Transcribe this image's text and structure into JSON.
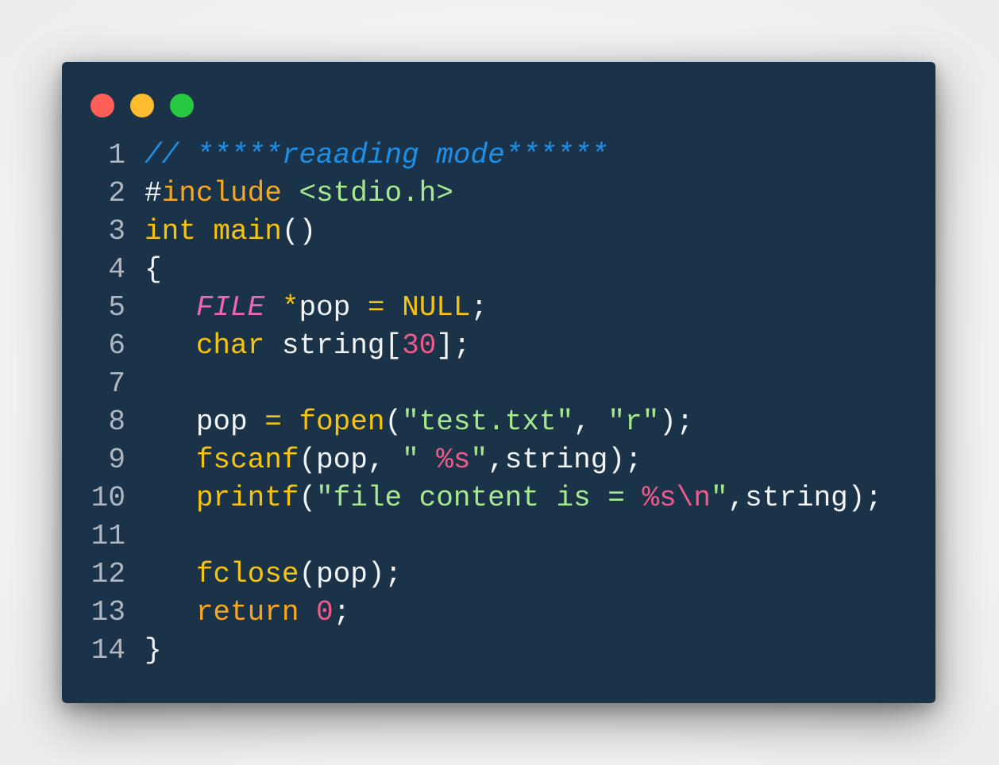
{
  "window": {
    "dots": [
      {
        "name": "close",
        "color": "#ff5f57"
      },
      {
        "name": "minimize",
        "color": "#febc2e"
      },
      {
        "name": "maximize",
        "color": "#28c840"
      }
    ]
  },
  "code": {
    "lines": [
      {
        "n": "1",
        "tokens": [
          [
            "cm",
            "// *****reaading mode******"
          ]
        ]
      },
      {
        "n": "2",
        "tokens": [
          [
            "pl",
            "#"
          ],
          [
            "kw",
            "include"
          ],
          [
            "pl",
            " "
          ],
          [
            "st",
            "<stdio.h>"
          ]
        ]
      },
      {
        "n": "3",
        "tokens": [
          [
            "ty",
            "int"
          ],
          [
            "pl",
            " "
          ],
          [
            "fn",
            "main"
          ],
          [
            "pl",
            "()"
          ]
        ]
      },
      {
        "n": "4",
        "tokens": [
          [
            "pl",
            "{"
          ]
        ]
      },
      {
        "n": "5",
        "tokens": [
          [
            "pl",
            "   "
          ],
          [
            "mac",
            "FILE"
          ],
          [
            "pl",
            " "
          ],
          [
            "op",
            "*"
          ],
          [
            "pl",
            "pop "
          ],
          [
            "op",
            "="
          ],
          [
            "pl",
            " "
          ],
          [
            "ty",
            "NULL"
          ],
          [
            "pl",
            ";"
          ]
        ]
      },
      {
        "n": "6",
        "tokens": [
          [
            "pl",
            "   "
          ],
          [
            "ty",
            "char"
          ],
          [
            "pl",
            " string["
          ],
          [
            "nm",
            "30"
          ],
          [
            "pl",
            "];"
          ]
        ]
      },
      {
        "n": "7",
        "tokens": []
      },
      {
        "n": "8",
        "tokens": [
          [
            "pl",
            "   pop "
          ],
          [
            "op",
            "="
          ],
          [
            "pl",
            " "
          ],
          [
            "fn",
            "fopen"
          ],
          [
            "pl",
            "("
          ],
          [
            "st",
            "\"test.txt\""
          ],
          [
            "pl",
            ", "
          ],
          [
            "st",
            "\"r\""
          ],
          [
            "pl",
            ");"
          ]
        ]
      },
      {
        "n": "9",
        "tokens": [
          [
            "pl",
            "   "
          ],
          [
            "fn",
            "fscanf"
          ],
          [
            "pl",
            "(pop, "
          ],
          [
            "st",
            "\" "
          ],
          [
            "fmt",
            "%s"
          ],
          [
            "st",
            "\""
          ],
          [
            "pl",
            ",string);"
          ]
        ]
      },
      {
        "n": "10",
        "tokens": [
          [
            "pl",
            "   "
          ],
          [
            "fn",
            "printf"
          ],
          [
            "pl",
            "("
          ],
          [
            "st",
            "\"file content is = "
          ],
          [
            "fmt",
            "%s\\n"
          ],
          [
            "st",
            "\""
          ],
          [
            "pl",
            ",string);"
          ]
        ]
      },
      {
        "n": "11",
        "tokens": []
      },
      {
        "n": "12",
        "tokens": [
          [
            "pl",
            "   "
          ],
          [
            "fn",
            "fclose"
          ],
          [
            "pl",
            "(pop);"
          ]
        ]
      },
      {
        "n": "13",
        "tokens": [
          [
            "pl",
            "   "
          ],
          [
            "kw",
            "return"
          ],
          [
            "pl",
            " "
          ],
          [
            "nm",
            "0"
          ],
          [
            "pl",
            ";"
          ]
        ]
      },
      {
        "n": "14",
        "tokens": [
          [
            "pl",
            "}"
          ]
        ]
      }
    ]
  }
}
